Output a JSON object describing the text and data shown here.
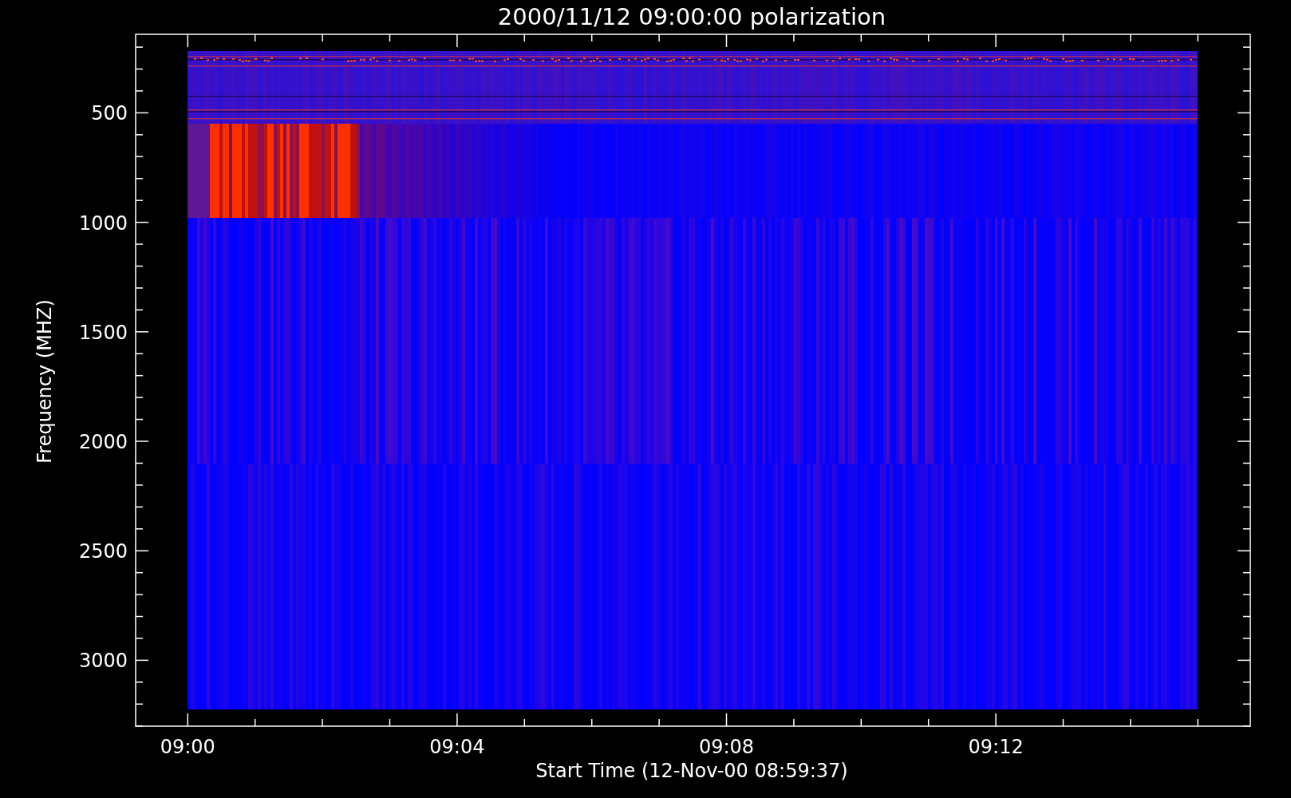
{
  "title": "2000/11/12 09:00:00 polarization",
  "y_axis": {
    "label": "Frequency (MHZ)",
    "ticks": [
      "500",
      "1000",
      "1500",
      "2000",
      "2500",
      "3000"
    ]
  },
  "x_axis": {
    "label": "Start Time (12-Nov-00 08:59:37)",
    "ticks": [
      "09:00",
      "09:04",
      "09:08",
      "09:12"
    ]
  }
}
